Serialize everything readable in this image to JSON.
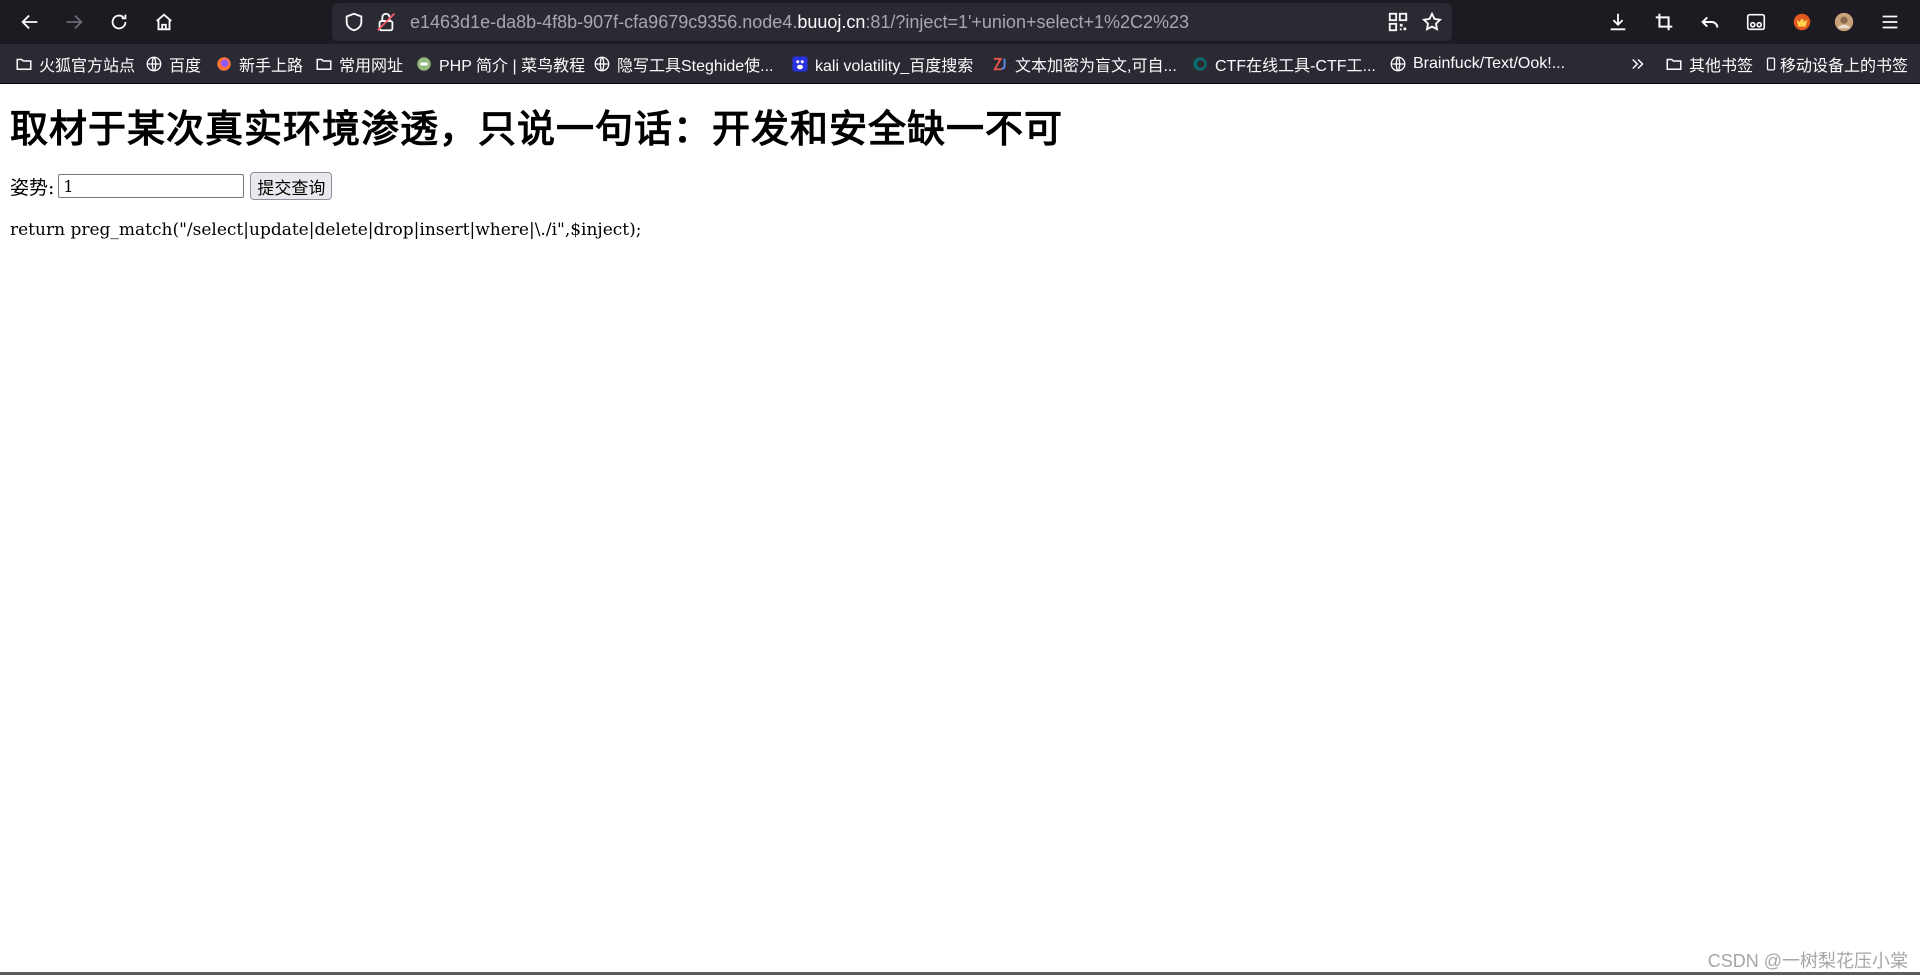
{
  "browser": {
    "url": {
      "prefix": "e1463d1e-da8b-4f8b-907f-cfa9679c9356.node4.",
      "domain": "buuoj.cn",
      "suffix": ":81/?inject=1'+union+select+1%2C2%23"
    },
    "icons": {
      "back": "back-arrow-icon",
      "forward": "forward-arrow-icon",
      "reload": "reload-icon",
      "home": "home-icon",
      "shield": "tracking-shield-icon",
      "lock": "insecure-lock-icon",
      "qr": "qr-code-icon",
      "star": "bookmark-star-icon",
      "download": "download-icon",
      "crop": "screenshot-crop-icon",
      "undo": "undo-icon",
      "reader": "reader-mode-icon",
      "extension": "extension-fox-icon",
      "profile": "profile-avatar-icon",
      "menu": "hamburger-menu-icon"
    }
  },
  "bookmarks": {
    "items": [
      {
        "label": "火狐官方站点",
        "icon": "folder-icon"
      },
      {
        "label": "百度",
        "icon": "globe-icon"
      },
      {
        "label": "新手上路",
        "icon": "firefox-icon"
      },
      {
        "label": "常用网址",
        "icon": "folder-icon"
      },
      {
        "label": "PHP 简介 | 菜鸟教程",
        "icon": "runoob-icon"
      },
      {
        "label": "隐写工具Steghide使...",
        "icon": "globe-icon"
      },
      {
        "label": "kali volatility_百度搜索",
        "icon": "baidu-paw-icon"
      },
      {
        "label": "文本加密为盲文,可自...",
        "icon": "zj-icon"
      },
      {
        "label": "CTF在线工具-CTF工...",
        "icon": "ctf-icon"
      },
      {
        "label": "Brainfuck/Text/Ook!...",
        "icon": "globe-icon"
      }
    ],
    "overflow_icon": "chevron-double-right-icon",
    "other_bookmarks": "其他书签",
    "mobile_bookmarks": "移动设备上的书签"
  },
  "page": {
    "title": "取材于某次真实环境渗透，只说一句话：开发和安全缺一不可",
    "form": {
      "label": "姿势:",
      "input_value": "1",
      "submit_label": "提交查询"
    },
    "code": "return preg_match(\"/select|update|delete|drop|insert|where|\\./i\",$inject);"
  },
  "watermark": "CSDN @一树梨花压小棠",
  "colors": {
    "toolbar_bg": "#1c1b22",
    "bookmarks_bg": "#2b2a33",
    "urlbar_bg": "#2b2a33",
    "page_bg": "#ffffff"
  }
}
